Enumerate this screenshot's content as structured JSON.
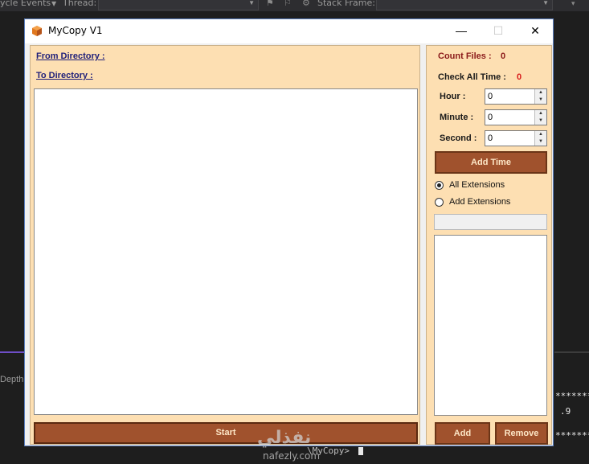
{
  "ide": {
    "toolbar_label_events": "ycle Events",
    "toolbar_label_thread": "Thread:",
    "toolbar_label_stack": "Stack Frame:",
    "side_label": "Depth",
    "console_line1": "*******",
    "console_line2": ".9",
    "console_line3": "*******",
    "console_prompt": "\\MyCopy>"
  },
  "window": {
    "title": "MyCopy V1",
    "minimize_glyph": "—",
    "maximize_glyph": "☐",
    "close_glyph": "✕"
  },
  "left": {
    "from_label": "From Directory :",
    "to_label": "To Directory :",
    "start_label": "Start"
  },
  "right": {
    "count_files_label": "Count Files :",
    "count_files_value": "0",
    "check_all_time_label": "Check All Time :",
    "check_all_time_value": "0",
    "hour_label": "Hour :",
    "hour_value": "0",
    "minute_label": "Minute :",
    "minute_value": "0",
    "second_label": "Second :",
    "second_value": "0",
    "add_time_label": "Add Time",
    "all_extensions_label": "All Extensions",
    "add_extensions_label": "Add Extensions",
    "extensions_input_value": "",
    "add_label": "Add",
    "remove_label": "Remove"
  },
  "watermark": {
    "text": "نفذلي",
    "subtext": "nafezly.com"
  },
  "colors": {
    "panel_bg": "#fddfb2",
    "button_bg": "#a0522d",
    "label_red": "#8b1a1a",
    "value_red": "#d81b1b"
  }
}
